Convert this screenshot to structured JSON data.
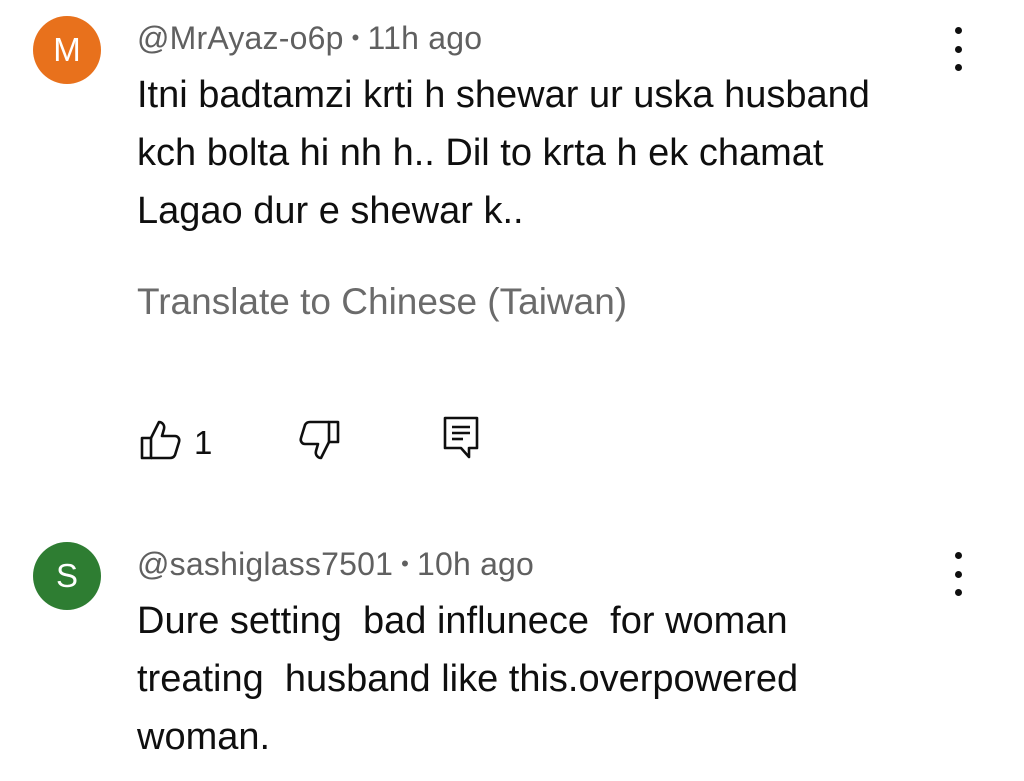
{
  "comments": [
    {
      "avatar_letter": "M",
      "avatar_color": "#e8711c",
      "handle": "@MrAyaz-o6p",
      "separator": "•",
      "time": "11h ago",
      "text_lines": [
        "Itni badtamzi krti h shewar ur uska husband",
        "kch bolta hi nh h.. Dil to krta h ek chamat",
        "Lagao dur e shewar k.."
      ],
      "translate_label": "Translate to Chinese (Taiwan)",
      "like_count": "1",
      "icons": [
        "thumbs-up-icon",
        "thumbs-down-icon",
        "reply-icon",
        "more-vert-icon"
      ]
    },
    {
      "avatar_letter": "S",
      "avatar_color": "#2e7d32",
      "handle": "@sashiglass7501",
      "separator": "•",
      "time": "10h ago",
      "text_lines": [
        "Dure setting  bad influnece  for woman",
        "treating  husband like this.overpowered",
        "woman."
      ],
      "icons": [
        "more-vert-icon"
      ]
    }
  ]
}
